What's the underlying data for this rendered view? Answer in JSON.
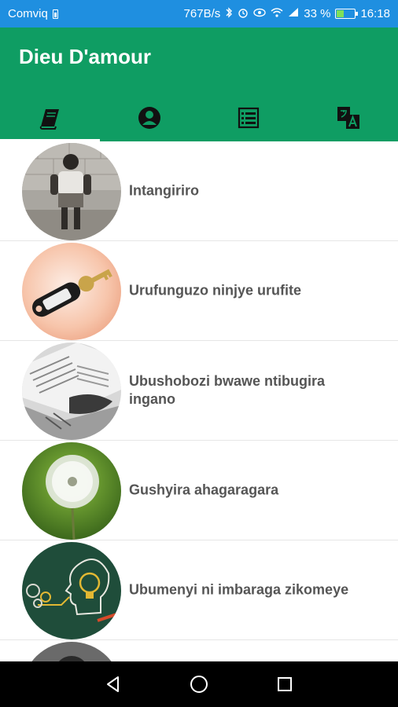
{
  "status_bar": {
    "carrier": "Comviq",
    "net_speed": "767B/s",
    "battery_pct": "33 %",
    "time": "16:18"
  },
  "app_bar": {
    "title": "Dieu D'amour",
    "bg_color": "#0f9d63",
    "active_tab_index": 0,
    "tabs": [
      {
        "icon": "book-icon"
      },
      {
        "icon": "account-icon"
      },
      {
        "icon": "list-icon"
      },
      {
        "icon": "translate-icon"
      }
    ]
  },
  "items": [
    {
      "label": "Intangiriro",
      "thumb": "child-photo"
    },
    {
      "label": "Urufunguzo ninjye urufite",
      "thumb": "key-photo"
    },
    {
      "label": "Ubushobozi bwawe ntibugira ingano",
      "thumb": "newspaper-photo"
    },
    {
      "label": "Gushyira ahagaragara",
      "thumb": "dandelion-photo"
    },
    {
      "label": "Ubumenyi ni imbaraga zikomeye",
      "thumb": "lightbulb-chalkboard"
    },
    {
      "label": "",
      "thumb": "person-photo"
    }
  ],
  "nav": [
    "back-icon",
    "home-icon",
    "recents-icon"
  ]
}
